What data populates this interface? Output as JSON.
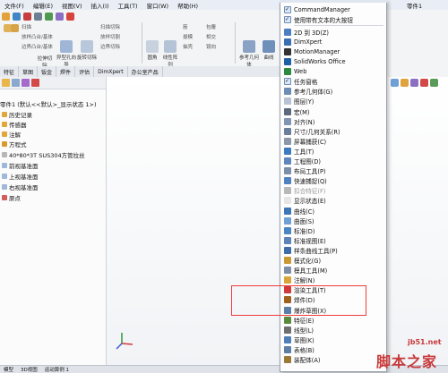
{
  "menu": {
    "items": [
      "文件(F)",
      "编辑(E)",
      "视图(V)",
      "插入(I)",
      "工具(T)",
      "窗口(W)",
      "帮助(H)"
    ]
  },
  "window": {
    "title_fragment": "零件1"
  },
  "toolbar": {
    "row1": [
      "扫描",
      "放样凸台/基体",
      "边界凸台/基体"
    ],
    "row2": [
      "拉伸切除",
      "异型孔向导",
      "旋转切除",
      "扫描切除",
      "放样切割",
      "边界切除"
    ],
    "big_buttons": [
      "圆角",
      "线性阵列",
      "筋",
      "拔模",
      "抽壳",
      "相交",
      "包覆",
      "镜向",
      "参考几何体",
      "曲线"
    ]
  },
  "tabs": [
    "特征",
    "草图",
    "钣金",
    "焊件",
    "评估",
    "DimXpert",
    "办公室产品"
  ],
  "tree": {
    "root": "零件1 (默认<<默认>_显示状态 1>)",
    "items": [
      "历史记录",
      "传感器",
      "注解",
      "方程式",
      "40*80*3T  SUS304方管拉丝",
      "前视基准面",
      "上视基准面",
      "右视基准面",
      "原点"
    ]
  },
  "dropdown": {
    "top": [
      {
        "label": "CommandManager",
        "checked": true
      },
      {
        "label": "使用带有文本的大按钮",
        "checked": true
      }
    ],
    "items": [
      {
        "label": "2D 到 3D(Z)",
        "checked": false,
        "color": "#4a7fc4"
      },
      {
        "label": "DimXpert",
        "checked": false,
        "color": "#3b6fb4"
      },
      {
        "label": "MotionManager",
        "checked": false,
        "color": "#333333"
      },
      {
        "label": "SolidWorks Office",
        "checked": false,
        "color": "#1f5fa6"
      },
      {
        "label": "Web",
        "checked": false,
        "color": "#2b8a3e"
      },
      {
        "label": "任务窗格",
        "checked": true,
        "color": "#5a8fd0"
      },
      {
        "label": "参考几何体(G)",
        "checked": false,
        "color": "#6b8db6"
      },
      {
        "label": "图层(Y)",
        "checked": false,
        "color": "#b7c3d3"
      },
      {
        "label": "宏(M)",
        "checked": false,
        "color": "#5b6b7d"
      },
      {
        "label": "对齐(N)",
        "checked": false,
        "color": "#7f95b3"
      },
      {
        "label": "尺寸/几何关系(R)",
        "checked": false,
        "color": "#6a7f9c"
      },
      {
        "label": "屏幕捕获(C)",
        "checked": false,
        "color": "#8c97a7"
      },
      {
        "label": "工具(T)",
        "checked": false,
        "color": "#3c7bbf"
      },
      {
        "label": "工程图(D)",
        "checked": false,
        "color": "#5e88bd"
      },
      {
        "label": "布局工具(P)",
        "checked": false,
        "color": "#7a8fa8"
      },
      {
        "label": "快速捕捉(Q)",
        "checked": false,
        "color": "#4e82c0"
      },
      {
        "label": "扣合特征(F)",
        "checked": false,
        "color": "#b8b8b8",
        "disabled": true
      },
      {
        "label": "显示状态(E)",
        "checked": false,
        "color": "#e6e6e6"
      },
      {
        "label": "曲线(C)",
        "checked": false,
        "color": "#3c75b8"
      },
      {
        "label": "曲面(S)",
        "checked": false,
        "color": "#6fa0d3"
      },
      {
        "label": "标准(D)",
        "checked": false,
        "color": "#4b86c4"
      },
      {
        "label": "标准视图(E)",
        "checked": false,
        "color": "#5c84b8"
      },
      {
        "label": "样条曲线工具(P)",
        "checked": false,
        "color": "#3d6ea8"
      },
      {
        "label": "模式化(G)",
        "checked": false,
        "color": "#c99a32"
      },
      {
        "label": "模具工具(M)",
        "checked": false,
        "color": "#7c8ea8"
      },
      {
        "label": "注解(N)",
        "checked": false,
        "color": "#d8a53a"
      },
      {
        "label": "渲染工具(T)",
        "checked": false,
        "color": "#d13a3a"
      },
      {
        "label": "焊件(D)",
        "checked": false,
        "color": "#a0631f"
      },
      {
        "label": "爆炸草图(X)",
        "checked": false,
        "color": "#5b7fa8"
      },
      {
        "label": "特征(E)",
        "checked": false,
        "color": "#5a8a3c"
      },
      {
        "label": "线型(L)",
        "checked": false,
        "color": "#6f6f6f"
      },
      {
        "label": "草图(K)",
        "checked": false,
        "color": "#4f7fb8"
      },
      {
        "label": "表格(B)",
        "checked": false,
        "color": "#5d7fa6"
      },
      {
        "label": "装配体(A)",
        "checked": false,
        "color": "#9b7a36"
      }
    ]
  },
  "watermark": {
    "site": "jb51.net",
    "name": "脚本之家"
  },
  "status": {
    "tabs": [
      "模型",
      "3D视图",
      "运动算例 1"
    ]
  }
}
